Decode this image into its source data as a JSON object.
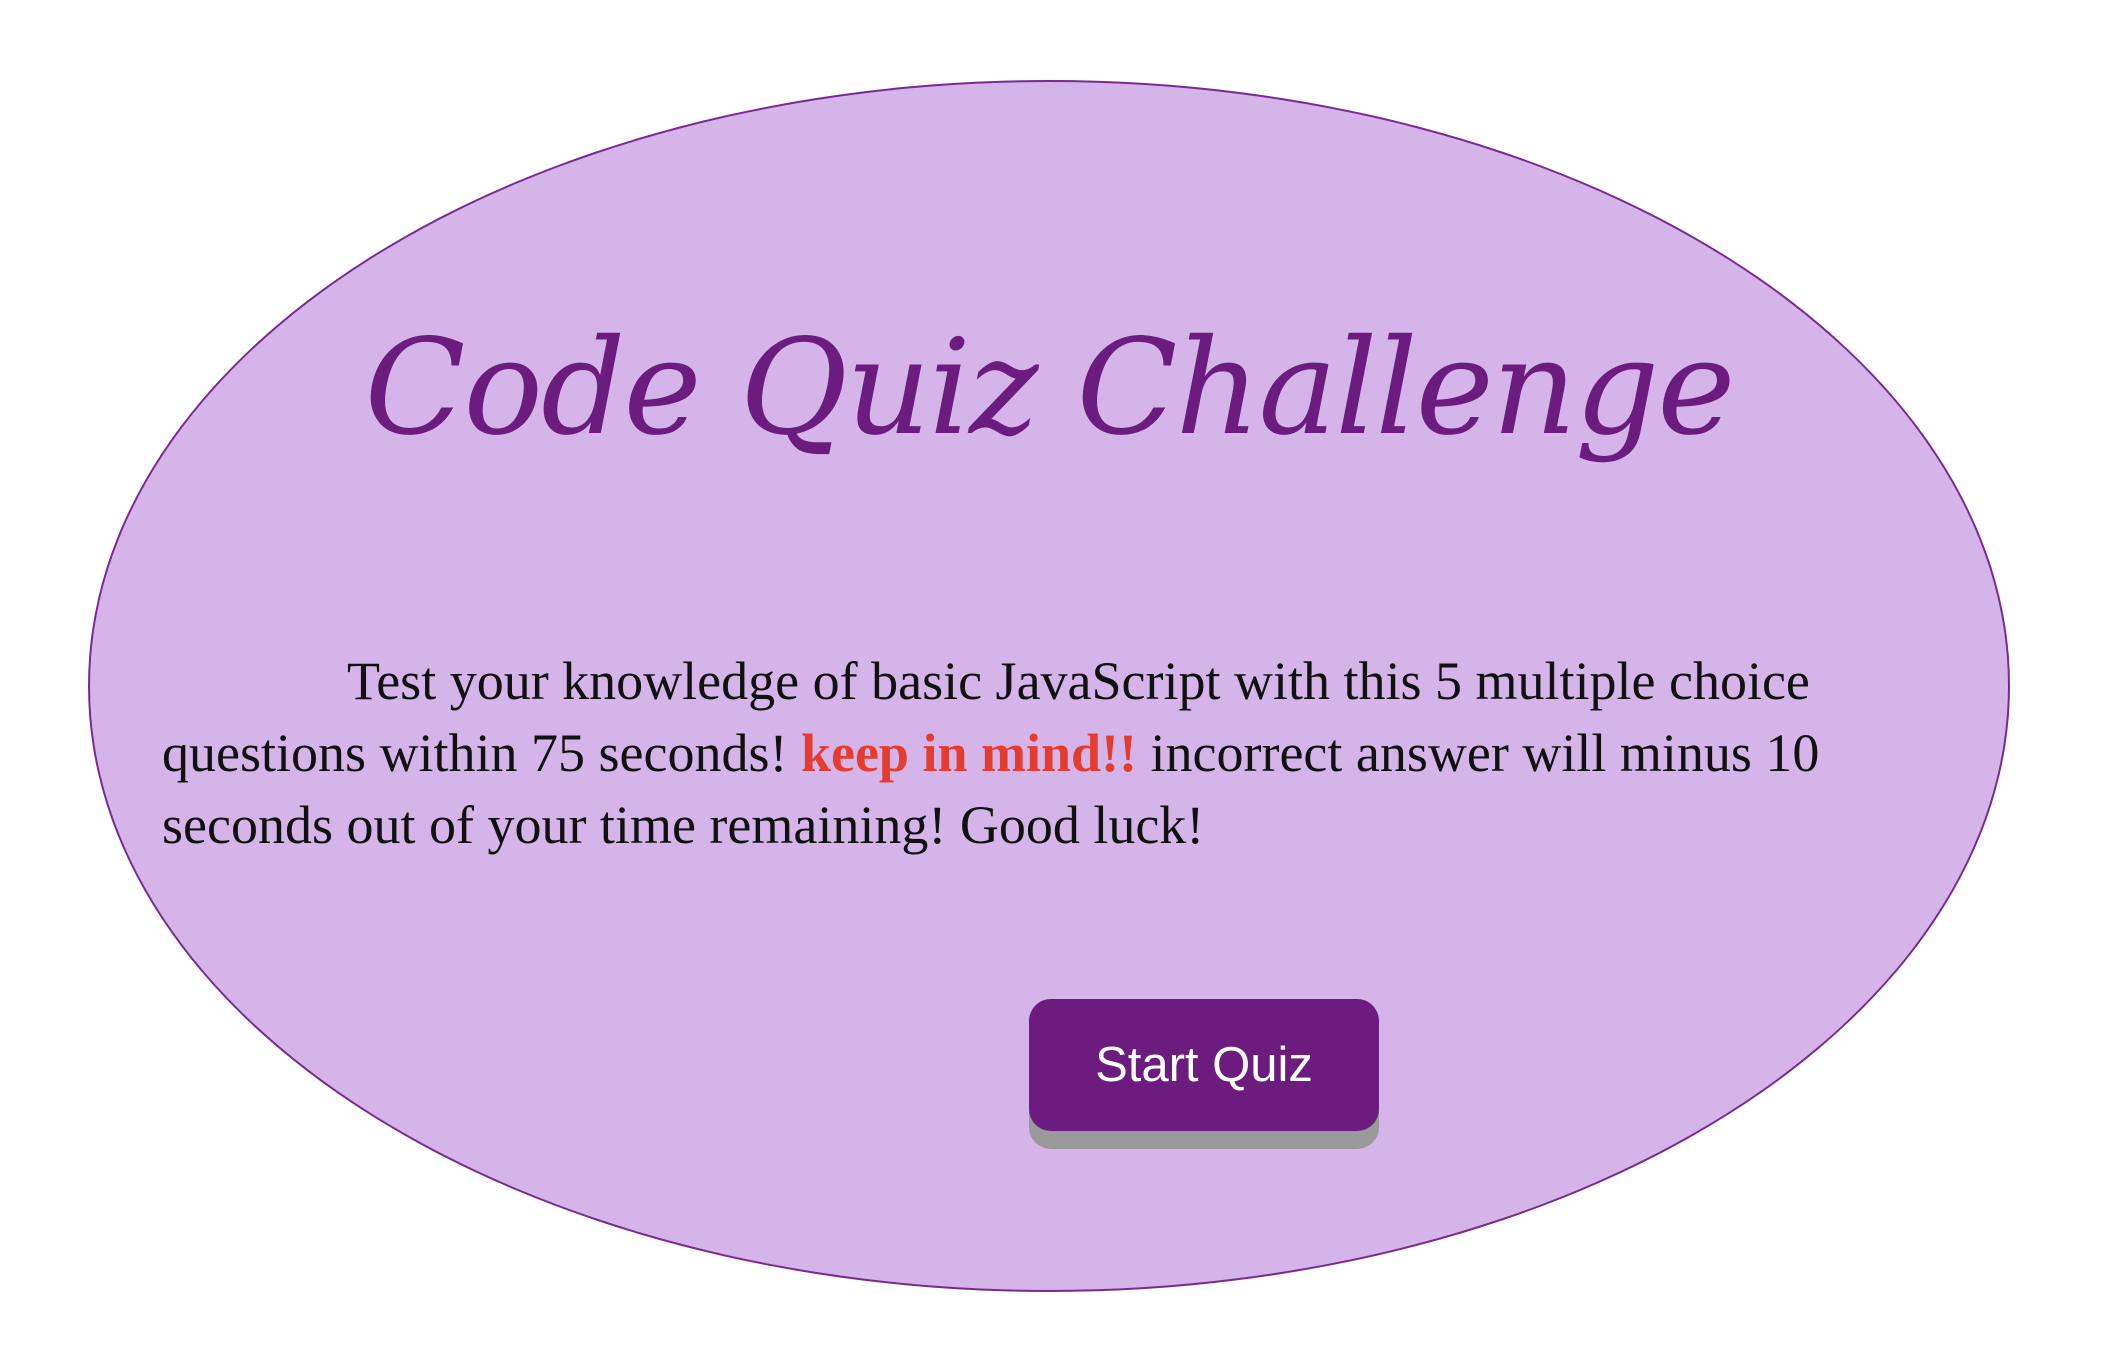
{
  "quiz": {
    "title": "Code Quiz Challenge",
    "description_before": "Test your knowledge of basic JavaScript with this 5 multiple choice questions within 75 seconds! ",
    "warning": "keep in mind!!",
    "description_after": " incorrect answer will minus 10 seconds out of your time remaining! Good luck!",
    "start_button_label": "Start Quiz"
  },
  "colors": {
    "card_background": "#d4b4e9",
    "card_border": "#7a2a8f",
    "title_text": "#6c1c7e",
    "warning_text": "#e43d30",
    "button_background": "#6c1c7e",
    "button_text": "#ffffff",
    "button_shadow": "#999999"
  }
}
